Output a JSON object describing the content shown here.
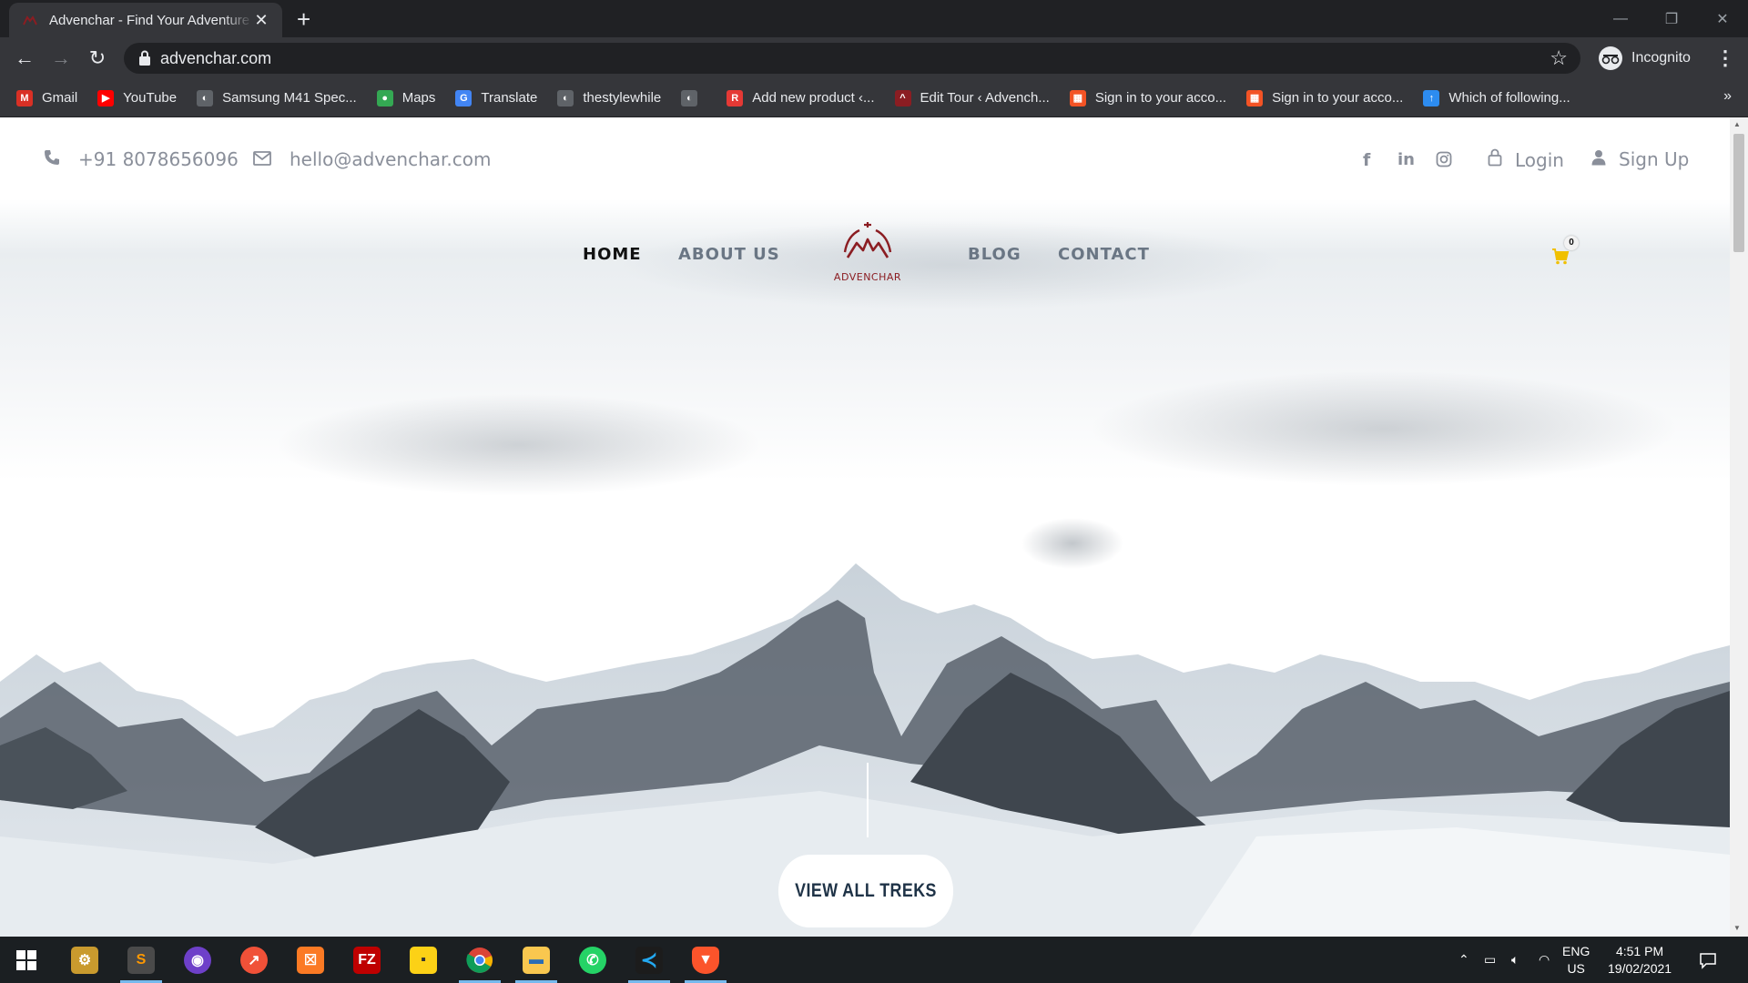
{
  "browser": {
    "tab_title": "Advenchar - Find Your Adventure",
    "tab_close": "✕",
    "new_tab": "+",
    "url": "advenchar.com",
    "profile_label": "Incognito",
    "bookmarks": [
      {
        "label": "Gmail",
        "icon": "gmail-icon",
        "color": "#d93025",
        "glyph": "M"
      },
      {
        "label": "YouTube",
        "icon": "youtube-icon",
        "color": "#ff0000",
        "glyph": "▶"
      },
      {
        "label": "Samsung M41 Spec...",
        "icon": "globe-icon",
        "color": "#5f6368",
        "glyph": "◐"
      },
      {
        "label": "Maps",
        "icon": "maps-icon",
        "color": "#34a853",
        "glyph": "●"
      },
      {
        "label": "Translate",
        "icon": "translate-icon",
        "color": "#4285f4",
        "glyph": "G"
      },
      {
        "label": "thestylewhile",
        "icon": "globe-icon",
        "color": "#5f6368",
        "glyph": "◐"
      },
      {
        "label": "",
        "icon": "globe-icon",
        "color": "#5f6368",
        "glyph": "◐"
      },
      {
        "label": "Add new product ‹...",
        "icon": "site-icon",
        "color": "#e53935",
        "glyph": "R"
      },
      {
        "label": "Edit Tour ‹ Advench...",
        "icon": "advenchar-icon",
        "color": "#8b1d22",
        "glyph": "^"
      },
      {
        "label": "Sign in to your acco...",
        "icon": "microsoft-icon",
        "color": "#f35325",
        "glyph": "▦"
      },
      {
        "label": "Sign in to your acco...",
        "icon": "microsoft-icon",
        "color": "#f35325",
        "glyph": "▦"
      },
      {
        "label": "Which of following...",
        "icon": "upload-icon",
        "color": "#2d8cf0",
        "glyph": "↑"
      }
    ],
    "bookmarks_more": "»"
  },
  "site": {
    "phone": "+91 8078656096",
    "email": "hello@advenchar.com",
    "login": "Login",
    "signup": "Sign Up",
    "nav": {
      "home": "HOME",
      "about": "ABOUT US",
      "blog": "BLOG",
      "contact": "CONTACT"
    },
    "logo_text": "ADVENCHAR",
    "cart_count": "0",
    "cta": "VIEW ALL TREKS",
    "brand_color": "#8b1d22"
  },
  "taskbar": {
    "apps": [
      "start-icon",
      "app-icon",
      "sublime-icon",
      "github-icon",
      "swift-icon",
      "xampp-icon",
      "filezilla-icon",
      "sticky-notes-icon",
      "chrome-icon",
      "file-explorer-icon",
      "whatsapp-icon",
      "vscode-icon",
      "brave-icon"
    ],
    "lang_line1": "ENG",
    "lang_line2": "US",
    "time": "4:51 PM",
    "date": "19/02/2021"
  }
}
